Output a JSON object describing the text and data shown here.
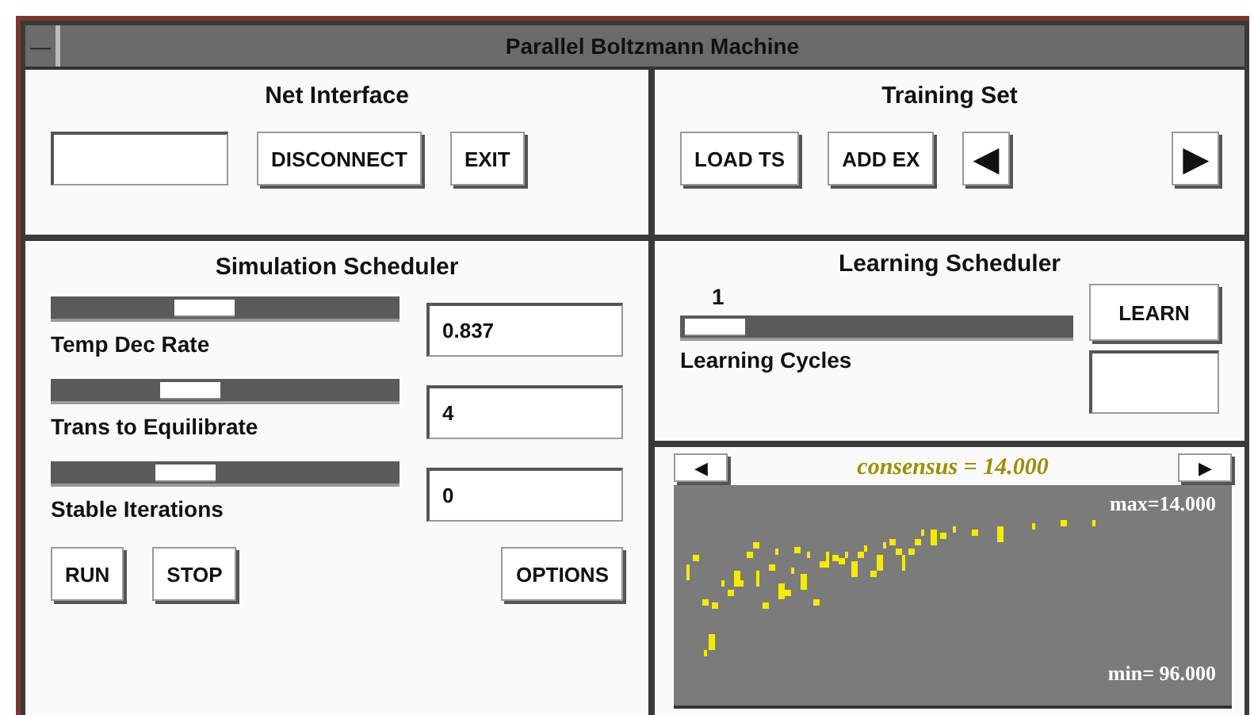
{
  "window": {
    "title": "Parallel Boltzmann Machine",
    "menu_symbol": "—"
  },
  "net_interface": {
    "title": "Net Interface",
    "buttons": [
      "DISCONNECT",
      "EXIT"
    ]
  },
  "training_set": {
    "title": "Training Set",
    "buttons": [
      "LOAD TS",
      "ADD EX"
    ],
    "prev_arrow": "◀",
    "next_arrow": "▶"
  },
  "simulation_scheduler": {
    "title": "Simulation Scheduler",
    "sliders": [
      {
        "label": "Temp Dec Rate",
        "level": 0.43,
        "value": "0.837"
      },
      {
        "label": "Trans to Equilibrate",
        "level": 0.38,
        "value": "4"
      },
      {
        "label": "Stable Iterations",
        "level": 0.36,
        "value": "0"
      }
    ],
    "buttons": [
      "RUN",
      "STOP"
    ],
    "options_button": "OPTIONS"
  },
  "learning_scheduler": {
    "title": "Learning Scheduler",
    "reading": "1",
    "level": 0.0,
    "slider_label": "Learning Cycles",
    "button": "LEARN"
  },
  "plot": {
    "title": "consensus = 14.000",
    "prev_arrow": "◀",
    "next_arrow": "▶",
    "max_label": "max=14.000",
    "min_label": "min= 96.000"
  }
}
